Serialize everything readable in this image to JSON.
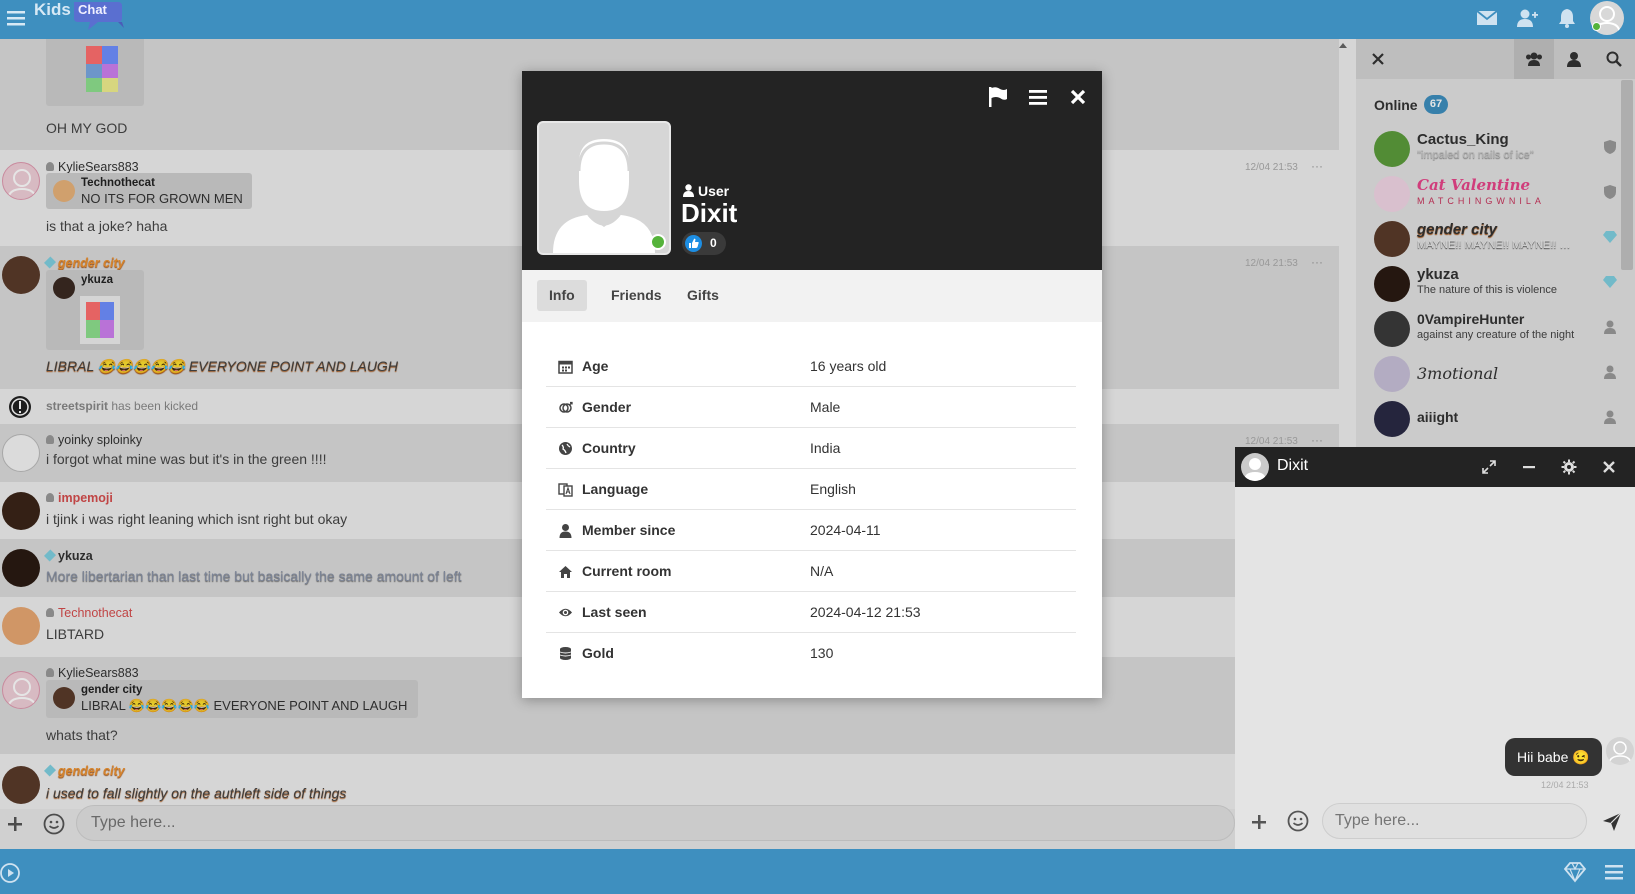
{
  "app": {
    "logo_kids": "Kids",
    "logo_chat": "Chat",
    "colors": {
      "accent": "#3e8fbf",
      "dark": "#232323",
      "online": "#55b33b"
    }
  },
  "composer": {
    "placeholder": "Type here..."
  },
  "chat": {
    "messages": [
      {
        "text": "OH MY GOD"
      },
      {
        "user": "KylieSears883",
        "quote_user": "Technothecat",
        "quote_text": "NO ITS FOR GROWN MEN",
        "text": "is that a joke? haha",
        "time": "12/04 21:53",
        "dots": "···"
      },
      {
        "user": "gender city",
        "quote_user": "ykuza",
        "text": "LIBRAL 😂😂😂😂😂 EVERYONE POINT AND LAUGH",
        "time": "12/04 21:53",
        "dots": "···"
      },
      {
        "user": "streetspirit",
        "text": "has been kicked"
      },
      {
        "user": "yoinky sploinky",
        "text": "i forgot what mine was but it's in the green !!!!",
        "time": "12/04 21:53",
        "dots": "···"
      },
      {
        "user": "impemoji",
        "text": "i tjink i was right leaning which isnt right but okay"
      },
      {
        "user": "ykuza",
        "text": "More libertarian than last time but basically the same amount of left"
      },
      {
        "user": "Technothecat",
        "text": "LIBTARD"
      },
      {
        "user": "KylieSears883",
        "quote_user": "gender city",
        "quote_text": "LIBRAL 😂😂😂😂😂 EVERYONE POINT AND LAUGH",
        "text": "whats that?"
      },
      {
        "user": "gender city",
        "text": "i used to fall slightly on the authleft side of things"
      }
    ]
  },
  "right_panel": {
    "online_label": "Online",
    "online_count": "67",
    "users": [
      {
        "name": "Cactus_King",
        "mood": "\"impaled on nails of ice\""
      },
      {
        "name": "Cat Valentine",
        "mood": "MATCHINGWNILA"
      },
      {
        "name": "gender city",
        "mood": "MAYNE!! MAYNE!! MAYNE!! MAYNE!!"
      },
      {
        "name": "ykuza",
        "mood": "The nature of this is violence"
      },
      {
        "name": "0VampireHunter",
        "mood": "against any creature of the night"
      },
      {
        "name": "3motional",
        "mood": ""
      },
      {
        "name": "aiiight",
        "mood": ""
      }
    ]
  },
  "profile": {
    "role": "User",
    "name": "Dixit",
    "likes": "0",
    "tabs": [
      "Info",
      "Friends",
      "Gifts"
    ],
    "rows": [
      {
        "label": "Age",
        "value": "16 years old",
        "icon": "calendar-icon"
      },
      {
        "label": "Gender",
        "value": "Male",
        "icon": "gender-icon"
      },
      {
        "label": "Country",
        "value": "India",
        "icon": "globe-icon"
      },
      {
        "label": "Language",
        "value": "English",
        "icon": "language-icon"
      },
      {
        "label": "Member since",
        "value": "2024-04-11",
        "icon": "user-icon"
      },
      {
        "label": "Current room",
        "value": "N/A",
        "icon": "home-icon"
      },
      {
        "label": "Last seen",
        "value": "2024-04-12 21:53",
        "icon": "eye-icon"
      },
      {
        "label": "Gold",
        "value": "130",
        "icon": "coins-icon"
      }
    ]
  },
  "private_chat": {
    "name": "Dixit",
    "message": "Hii babe 😉",
    "time": "12/04 21:53",
    "placeholder": "Type here..."
  }
}
